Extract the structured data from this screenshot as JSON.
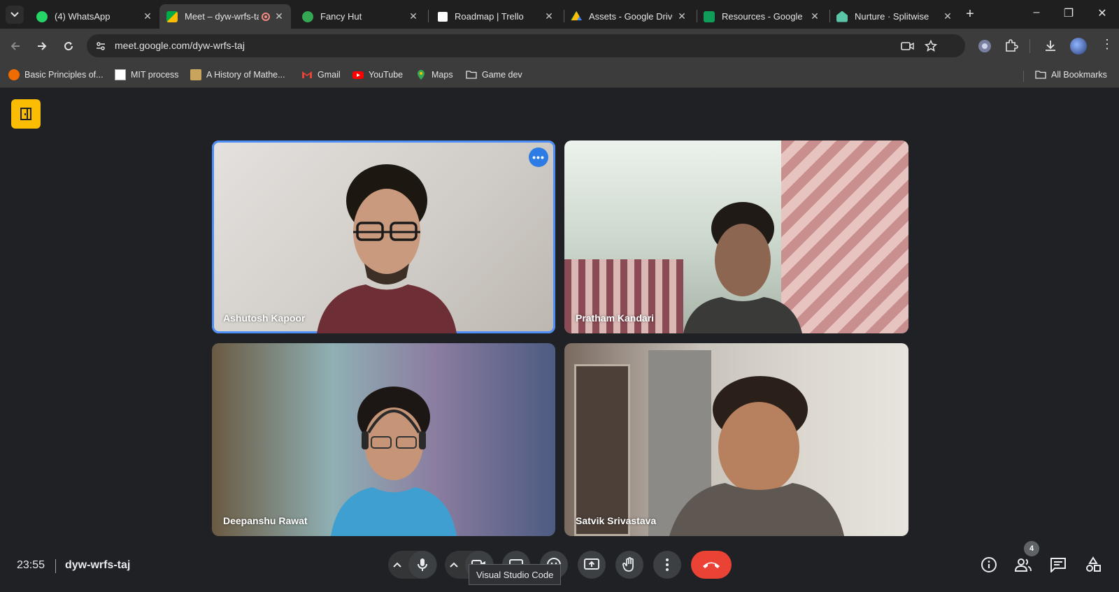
{
  "browser": {
    "tabs": [
      {
        "title": "(4) WhatsApp",
        "favicon": "whatsapp-icon",
        "color": "#25d366",
        "active": false
      },
      {
        "title": "Meet – dyw-wrfs-taj",
        "favicon": "google-meet-icon",
        "color": "#00ac47",
        "active": true,
        "recording": true
      },
      {
        "title": "Fancy Hut",
        "favicon": "fancy-hut-icon",
        "color": "#34a853",
        "active": false
      },
      {
        "title": "Roadmap | Trello",
        "favicon": "trello-icon",
        "color": "#ffffff",
        "active": false
      },
      {
        "title": "Assets - Google Drive",
        "favicon": "google-drive-icon",
        "color": "#fbbc04",
        "active": false
      },
      {
        "title": "Resources - Google Sheets",
        "favicon": "google-sheets-icon",
        "color": "#0f9d58",
        "active": false
      },
      {
        "title": "Nurture · Splitwise",
        "favicon": "splitwise-icon",
        "color": "#5bc5a7",
        "active": false
      }
    ],
    "new_tab_label": "+",
    "url": "meet.google.com/dyw-wrfs-taj",
    "bookmarks": [
      {
        "label": "Basic Principles of...",
        "icon": "c-logo-icon",
        "color": "#ef6c00"
      },
      {
        "label": "MIT process",
        "icon": "document-icon",
        "color": "#ffffff"
      },
      {
        "label": "A History of Mathe...",
        "icon": "book-icon",
        "color": "#c9a45c"
      },
      {
        "label": "Gmail",
        "icon": "gmail-icon",
        "color": "#ea4335"
      },
      {
        "label": "YouTube",
        "icon": "youtube-icon",
        "color": "#ff0000"
      },
      {
        "label": "Maps",
        "icon": "maps-icon",
        "color": "#34a853"
      },
      {
        "label": "Game dev",
        "icon": "folder-icon",
        "color": "#e3e3e3"
      }
    ],
    "all_bookmarks_label": "All Bookmarks"
  },
  "meet": {
    "participants": [
      {
        "name": "Ashutosh Kapoor",
        "speaking": true
      },
      {
        "name": "Pratham Kandari",
        "speaking": false
      },
      {
        "name": "Deepanshu Rawat",
        "speaking": false
      },
      {
        "name": "Satvik Srivastava",
        "speaking": false
      }
    ],
    "more_options_label": "•••",
    "clock": "23:55",
    "meeting_code": "dyw-wrfs-taj",
    "people_count": "4",
    "tooltip": "Visual Studio Code",
    "colors": {
      "accent": "#4c8df6",
      "end_call": "#ea4335",
      "badge": "#fbbc04"
    }
  }
}
